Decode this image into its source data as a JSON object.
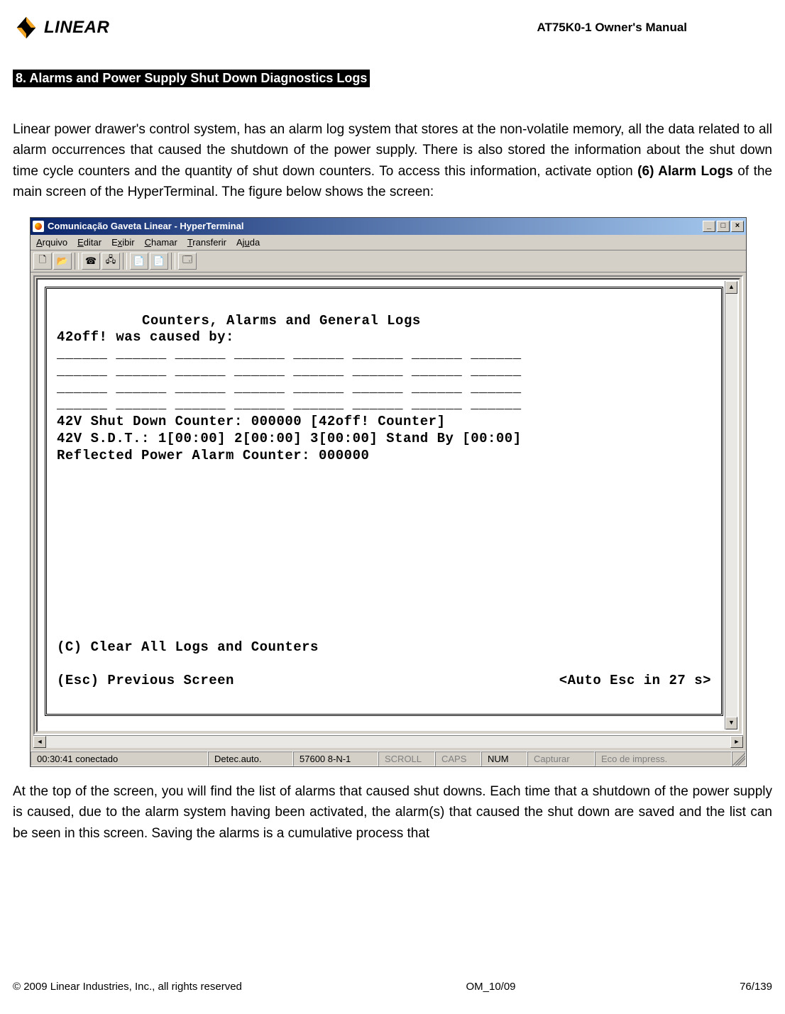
{
  "header": {
    "logo_text": "LINEAR",
    "doc_title": "AT75K0-1 Owner's Manual"
  },
  "section": {
    "heading": "8. Alarms and Power Supply Shut Down Diagnostics Logs",
    "intro_before_bold": "Linear power drawer's control system, has an alarm log system that stores at the non-volatile memory, all the data related to all alarm occurrences that caused the shutdown of the power supply. There is also stored the information about the shut down time cycle counters and the quantity of shut down counters. To access this information, activate option ",
    "intro_bold": "(6) Alarm Logs",
    "intro_after_bold": " of the main screen of the HyperTerminal. The figure below shows the screen:",
    "outro": "At the top of the screen, you will find the list of alarms that caused shut downs. Each time that a shutdown of the power supply is caused, due to the alarm system having been activated, the alarm(s) that caused the shut down are saved and the list can be seen in this screen. Saving the alarms is a cumulative process that"
  },
  "window": {
    "title": "Comunicação Gaveta Linear - HyperTerminal",
    "menu": {
      "arquivo": "Arquivo",
      "editar": "Editar",
      "exibir": "Exibir",
      "chamar": "Chamar",
      "transferir": "Transferir",
      "ajuda": "Ajuda"
    },
    "win_btns": {
      "min": "_",
      "max": "□",
      "close": "×"
    },
    "toolbar_icons": {
      "new": "🗋",
      "open": "📂",
      "connect": "☎",
      "disconnect": "🖧",
      "send": "📄",
      "receive": "📄",
      "props": "🗔"
    },
    "scroll": {
      "up": "▲",
      "down": "▼",
      "left": "◄",
      "right": "►"
    }
  },
  "terminal": {
    "title": "Counters, Alarms and General Logs",
    "line_caused": "42off! was caused by:",
    "dash_row": "______ ______ ______ ______ ______ ______ ______ ______",
    "line_sd_counter": "42V Shut Down Counter: 000000 [42off! Counter]",
    "line_sdt": "42V S.D.T.: 1[00:00] 2[00:00] 3[00:00] Stand By [00:00]",
    "line_refl": "Reflected Power Alarm Counter: 000000",
    "opt_clear": "(C) Clear All Logs and Counters",
    "opt_prev": "(Esc) Previous Screen",
    "auto_esc": "<Auto Esc in 27 s>"
  },
  "status": {
    "s1": "00:30:41 conectado",
    "s2": "Detec.auto.",
    "s3": "57600 8-N-1",
    "s4": "SCROLL",
    "s5": "CAPS",
    "s6": "NUM",
    "s7": "Capturar",
    "s8": "Eco de impress."
  },
  "footer": {
    "left": "© 2009 Linear Industries, Inc., all rights reserved",
    "center": "OM_10/09",
    "right": "76/139"
  }
}
